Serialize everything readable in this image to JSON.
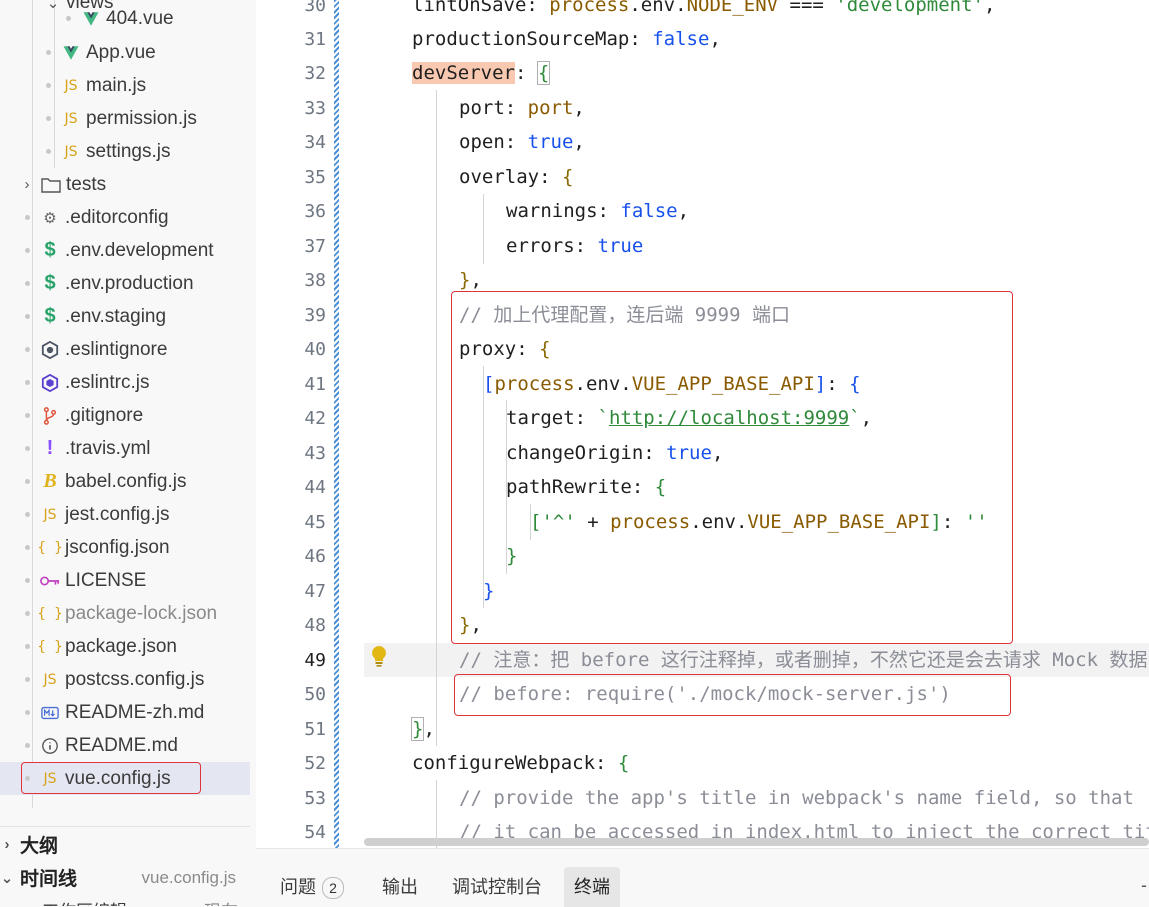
{
  "explorer": {
    "items": [
      {
        "label": "views",
        "icon": "folder-open-icon"
      },
      {
        "label": "404.vue",
        "icon": "vue-icon"
      },
      {
        "label": "App.vue",
        "icon": "vue-icon"
      },
      {
        "label": "main.js",
        "icon": "js-icon"
      },
      {
        "label": "permission.js",
        "icon": "js-icon"
      },
      {
        "label": "settings.js",
        "icon": "js-icon"
      },
      {
        "label": "tests",
        "icon": "folder-icon"
      },
      {
        "label": ".editorconfig",
        "icon": "gear-icon"
      },
      {
        "label": ".env.development",
        "icon": "dollar-icon"
      },
      {
        "label": ".env.production",
        "icon": "dollar-icon"
      },
      {
        "label": ".env.staging",
        "icon": "dollar-icon"
      },
      {
        "label": ".eslintignore",
        "icon": "eslint-icon"
      },
      {
        "label": ".eslintrc.js",
        "icon": "eslint-icon"
      },
      {
        "label": ".gitignore",
        "icon": "git-icon"
      },
      {
        "label": ".travis.yml",
        "icon": "exclamation-icon"
      },
      {
        "label": "babel.config.js",
        "icon": "babel-icon"
      },
      {
        "label": "jest.config.js",
        "icon": "js-icon"
      },
      {
        "label": "jsconfig.json",
        "icon": "json-icon"
      },
      {
        "label": "LICENSE",
        "icon": "license-icon"
      },
      {
        "label": "package-lock.json",
        "icon": "json-icon"
      },
      {
        "label": "package.json",
        "icon": "json-icon"
      },
      {
        "label": "postcss.config.js",
        "icon": "js-icon"
      },
      {
        "label": "README-zh.md",
        "icon": "markdown-icon"
      },
      {
        "label": "README.md",
        "icon": "info-icon"
      },
      {
        "label": "vue.config.js",
        "icon": "js-icon"
      }
    ],
    "icon_glyphs": {
      "js": "JS",
      "json": "{ }",
      "dollar": "$",
      "bang": "!",
      "babel": "B"
    },
    "outline_label": "大纲",
    "timeline_label": "时间线",
    "timeline_file": "vue.config.js",
    "timeline_entry": "工作区编辑",
    "timeline_entry_time": "现在"
  },
  "editor": {
    "line_numbers": [
      "30",
      "31",
      "32",
      "33",
      "34",
      "35",
      "36",
      "37",
      "38",
      "39",
      "40",
      "41",
      "42",
      "43",
      "44",
      "45",
      "46",
      "47",
      "48",
      "49",
      "50",
      "51",
      "52",
      "53",
      "54"
    ],
    "active_line": "49",
    "code": {
      "l30": {
        "key": "lintOnSave",
        "colon": ": ",
        "p1": "process",
        "dot1": ".env.",
        "p2": "NODE_ENV",
        "op": " === ",
        "str": "'development'",
        "end": ","
      },
      "l31": {
        "key": "productionSourceMap",
        "colon": ": ",
        "val": "false",
        "end": ","
      },
      "l32": {
        "key": "devServer",
        "colon": ": ",
        "brace": "{"
      },
      "l33": {
        "key": "port",
        "colon": ": ",
        "val": "port",
        "end": ","
      },
      "l34": {
        "key": "open",
        "colon": ": ",
        "val": "true",
        "end": ","
      },
      "l35": {
        "key": "overlay",
        "colon": ": ",
        "brace": "{"
      },
      "l36": {
        "key": "warnings",
        "colon": ": ",
        "val": "false",
        "end": ","
      },
      "l37": {
        "key": "errors",
        "colon": ": ",
        "val": "true"
      },
      "l38": {
        "brace": "}",
        "end": ","
      },
      "l39": {
        "comment": "// 加上代理配置，连后端 9999 端口"
      },
      "l40": {
        "key": "proxy",
        "colon": ": ",
        "brace": "{"
      },
      "l41": {
        "open": "[",
        "p1": "process",
        "dot": ".env.",
        "p2": "VUE_APP_BASE_API",
        "close": "]",
        "colon": ": ",
        "brace": "{"
      },
      "l42": {
        "key": "target",
        "colon": ": ",
        "tick1": "`",
        "url": "http://localhost:9999",
        "tick2": "`",
        "end": ","
      },
      "l43": {
        "key": "changeOrigin",
        "colon": ": ",
        "val": "true",
        "end": ","
      },
      "l44": {
        "key": "pathRewrite",
        "colon": ": ",
        "brace": "{"
      },
      "l45": {
        "open": "[",
        "str": "'^'",
        "plus": " + ",
        "p1": "process",
        "dot": ".env.",
        "p2": "VUE_APP_BASE_API",
        "close": "]",
        "colon": ": ",
        "str2": "''"
      },
      "l46": {
        "brace": "}"
      },
      "l47": {
        "brace": "}"
      },
      "l48": {
        "brace": "}",
        "end": ","
      },
      "l49": {
        "comment": "// 注意：把 before 这行注释掉，或者删掉，不然它还是会去请求 Mock 数据"
      },
      "l50": {
        "comment": "// before: require('./mock/mock-server.js')"
      },
      "l51": {
        "brace": "}",
        "end": ","
      },
      "l52": {
        "key": "configureWebpack",
        "colon": ": ",
        "brace": "{"
      },
      "l53": {
        "comment": "// provide the app's title in webpack's name field, so that"
      },
      "l54": {
        "comment": "// it can be accessed in index.html to inject the correct title."
      }
    }
  },
  "panel": {
    "tabs": [
      {
        "label": "问题",
        "badge": "2"
      },
      {
        "label": "输出"
      },
      {
        "label": "调试控制台"
      },
      {
        "label": "终端",
        "active": true
      }
    ],
    "right_symbol": "-"
  },
  "colors": {
    "annotation": "#e0343c",
    "selection": "#e4e6f1",
    "devserver_highlight": "#f9c8b0"
  }
}
